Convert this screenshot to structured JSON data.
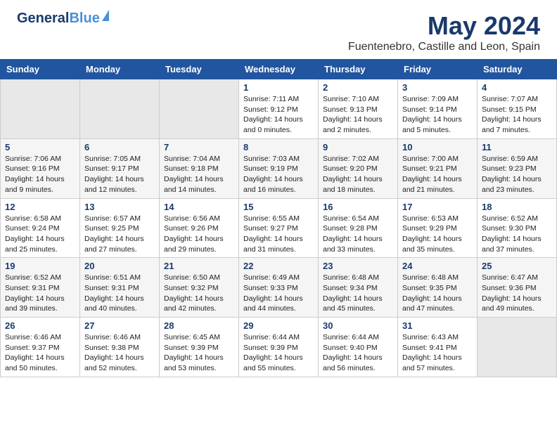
{
  "header": {
    "logo_general": "General",
    "logo_blue": "Blue",
    "title": "May 2024",
    "subtitle": "Fuentenebro, Castille and Leon, Spain"
  },
  "calendar": {
    "weekdays": [
      "Sunday",
      "Monday",
      "Tuesday",
      "Wednesday",
      "Thursday",
      "Friday",
      "Saturday"
    ],
    "weeks": [
      [
        {
          "day": "",
          "info": ""
        },
        {
          "day": "",
          "info": ""
        },
        {
          "day": "",
          "info": ""
        },
        {
          "day": "1",
          "info": "Sunrise: 7:11 AM\nSunset: 9:12 PM\nDaylight: 14 hours\nand 0 minutes."
        },
        {
          "day": "2",
          "info": "Sunrise: 7:10 AM\nSunset: 9:13 PM\nDaylight: 14 hours\nand 2 minutes."
        },
        {
          "day": "3",
          "info": "Sunrise: 7:09 AM\nSunset: 9:14 PM\nDaylight: 14 hours\nand 5 minutes."
        },
        {
          "day": "4",
          "info": "Sunrise: 7:07 AM\nSunset: 9:15 PM\nDaylight: 14 hours\nand 7 minutes."
        }
      ],
      [
        {
          "day": "5",
          "info": "Sunrise: 7:06 AM\nSunset: 9:16 PM\nDaylight: 14 hours\nand 9 minutes."
        },
        {
          "day": "6",
          "info": "Sunrise: 7:05 AM\nSunset: 9:17 PM\nDaylight: 14 hours\nand 12 minutes."
        },
        {
          "day": "7",
          "info": "Sunrise: 7:04 AM\nSunset: 9:18 PM\nDaylight: 14 hours\nand 14 minutes."
        },
        {
          "day": "8",
          "info": "Sunrise: 7:03 AM\nSunset: 9:19 PM\nDaylight: 14 hours\nand 16 minutes."
        },
        {
          "day": "9",
          "info": "Sunrise: 7:02 AM\nSunset: 9:20 PM\nDaylight: 14 hours\nand 18 minutes."
        },
        {
          "day": "10",
          "info": "Sunrise: 7:00 AM\nSunset: 9:21 PM\nDaylight: 14 hours\nand 21 minutes."
        },
        {
          "day": "11",
          "info": "Sunrise: 6:59 AM\nSunset: 9:23 PM\nDaylight: 14 hours\nand 23 minutes."
        }
      ],
      [
        {
          "day": "12",
          "info": "Sunrise: 6:58 AM\nSunset: 9:24 PM\nDaylight: 14 hours\nand 25 minutes."
        },
        {
          "day": "13",
          "info": "Sunrise: 6:57 AM\nSunset: 9:25 PM\nDaylight: 14 hours\nand 27 minutes."
        },
        {
          "day": "14",
          "info": "Sunrise: 6:56 AM\nSunset: 9:26 PM\nDaylight: 14 hours\nand 29 minutes."
        },
        {
          "day": "15",
          "info": "Sunrise: 6:55 AM\nSunset: 9:27 PM\nDaylight: 14 hours\nand 31 minutes."
        },
        {
          "day": "16",
          "info": "Sunrise: 6:54 AM\nSunset: 9:28 PM\nDaylight: 14 hours\nand 33 minutes."
        },
        {
          "day": "17",
          "info": "Sunrise: 6:53 AM\nSunset: 9:29 PM\nDaylight: 14 hours\nand 35 minutes."
        },
        {
          "day": "18",
          "info": "Sunrise: 6:52 AM\nSunset: 9:30 PM\nDaylight: 14 hours\nand 37 minutes."
        }
      ],
      [
        {
          "day": "19",
          "info": "Sunrise: 6:52 AM\nSunset: 9:31 PM\nDaylight: 14 hours\nand 39 minutes."
        },
        {
          "day": "20",
          "info": "Sunrise: 6:51 AM\nSunset: 9:31 PM\nDaylight: 14 hours\nand 40 minutes."
        },
        {
          "day": "21",
          "info": "Sunrise: 6:50 AM\nSunset: 9:32 PM\nDaylight: 14 hours\nand 42 minutes."
        },
        {
          "day": "22",
          "info": "Sunrise: 6:49 AM\nSunset: 9:33 PM\nDaylight: 14 hours\nand 44 minutes."
        },
        {
          "day": "23",
          "info": "Sunrise: 6:48 AM\nSunset: 9:34 PM\nDaylight: 14 hours\nand 45 minutes."
        },
        {
          "day": "24",
          "info": "Sunrise: 6:48 AM\nSunset: 9:35 PM\nDaylight: 14 hours\nand 47 minutes."
        },
        {
          "day": "25",
          "info": "Sunrise: 6:47 AM\nSunset: 9:36 PM\nDaylight: 14 hours\nand 49 minutes."
        }
      ],
      [
        {
          "day": "26",
          "info": "Sunrise: 6:46 AM\nSunset: 9:37 PM\nDaylight: 14 hours\nand 50 minutes."
        },
        {
          "day": "27",
          "info": "Sunrise: 6:46 AM\nSunset: 9:38 PM\nDaylight: 14 hours\nand 52 minutes."
        },
        {
          "day": "28",
          "info": "Sunrise: 6:45 AM\nSunset: 9:39 PM\nDaylight: 14 hours\nand 53 minutes."
        },
        {
          "day": "29",
          "info": "Sunrise: 6:44 AM\nSunset: 9:39 PM\nDaylight: 14 hours\nand 55 minutes."
        },
        {
          "day": "30",
          "info": "Sunrise: 6:44 AM\nSunset: 9:40 PM\nDaylight: 14 hours\nand 56 minutes."
        },
        {
          "day": "31",
          "info": "Sunrise: 6:43 AM\nSunset: 9:41 PM\nDaylight: 14 hours\nand 57 minutes."
        },
        {
          "day": "",
          "info": ""
        }
      ]
    ]
  }
}
